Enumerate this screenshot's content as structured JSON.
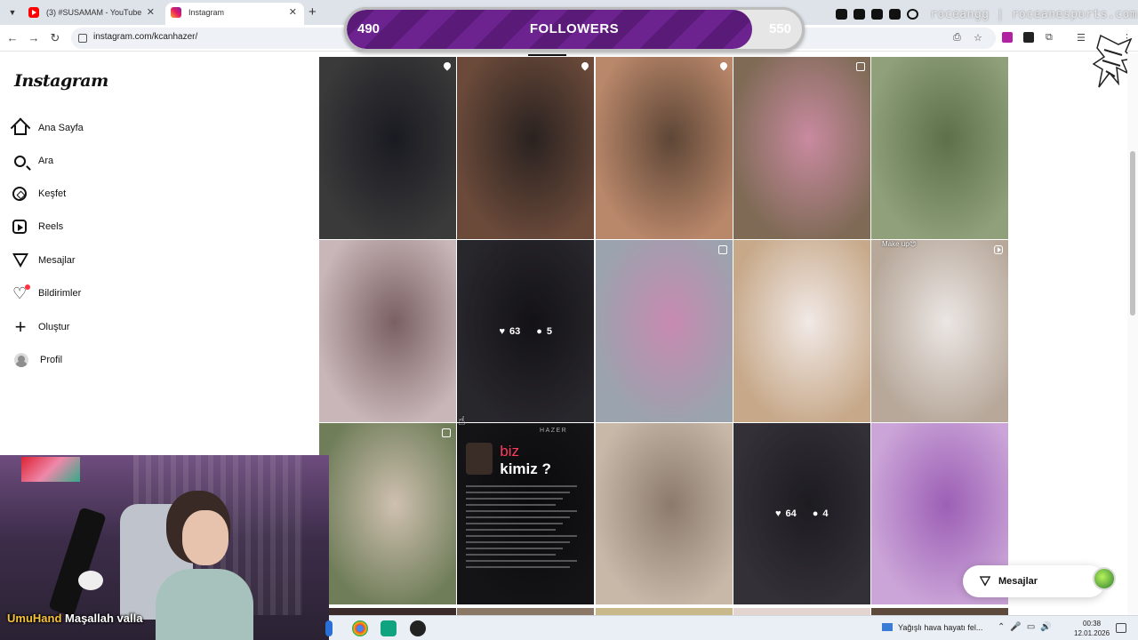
{
  "browser": {
    "tabs": [
      {
        "title": "(3) #SUSAMAM - YouTube",
        "icon": "youtube-icon"
      },
      {
        "title": "Instagram",
        "icon": "instagram-icon"
      }
    ],
    "url": "instagram.com/kcanhazer/"
  },
  "stream": {
    "goal": {
      "start": "490",
      "label": "FOLLOWERS",
      "end": "550",
      "progress": 0.89
    },
    "handles": "roceangg | roceanesports.com",
    "chat": {
      "user": "UmuHand",
      "message": "Maşallah valla"
    }
  },
  "sidebar": {
    "logo": "Instagram",
    "items": [
      {
        "label": "Ana Sayfa",
        "icon": "home-icon"
      },
      {
        "label": "Ara",
        "icon": "search-icon"
      },
      {
        "label": "Keşfet",
        "icon": "compass-icon"
      },
      {
        "label": "Reels",
        "icon": "reels-icon"
      },
      {
        "label": "Mesajlar",
        "icon": "send-icon"
      },
      {
        "label": "Bildirimler",
        "icon": "heart-icon"
      },
      {
        "label": "Oluştur",
        "icon": "plus-icon"
      },
      {
        "label": "Profil",
        "icon": "avatar-icon"
      }
    ]
  },
  "grid": {
    "posts": [
      {
        "badge": "pin",
        "colors": [
          "#3a3a3a",
          "#1a1a22"
        ]
      },
      {
        "badge": "pin",
        "colors": [
          "#6b4a3a",
          "#2a2220"
        ]
      },
      {
        "badge": "pin",
        "colors": [
          "#b9876a",
          "#5e4636"
        ]
      },
      {
        "badge": "multi",
        "colors": [
          "#7e6a55",
          "#c98aa0"
        ]
      },
      {
        "badge": "",
        "colors": [
          "#8fa07a",
          "#5d7049"
        ]
      },
      {
        "badge": "",
        "colors": [
          "#c8b6b8",
          "#7a6062"
        ]
      },
      {
        "badge": "",
        "colors": [
          "#3a3840",
          "#1c1a20"
        ],
        "likes": "63",
        "comments": "5"
      },
      {
        "badge": "multi",
        "colors": [
          "#9aa3ae",
          "#c78ab0"
        ]
      },
      {
        "badge": "",
        "colors": [
          "#c7a98a",
          "#f1e9e6"
        ]
      },
      {
        "badge": "reel",
        "colors": [
          "#b7a89a",
          "#ebe6e4"
        ],
        "tag": "Make up😍"
      },
      {
        "badge": "multi",
        "colors": [
          "#6f7d59",
          "#cfc0b0"
        ]
      },
      {
        "badge": "",
        "colors": [
          "#141416",
          "#0a0a0c"
        ],
        "brand": "HAZER",
        "title_accent": "biz",
        "title": "kimiz ?"
      },
      {
        "badge": "",
        "colors": [
          "#c7b8a8",
          "#8c7b6d"
        ]
      },
      {
        "badge": "",
        "colors": [
          "#4a4650",
          "#2a2830"
        ],
        "likes": "64",
        "comments": "4"
      },
      {
        "badge": "",
        "colors": [
          "#cba5d8",
          "#9c5fb5"
        ]
      }
    ]
  },
  "messages_pill": {
    "label": "Mesajlar"
  },
  "taskbar": {
    "weather": "Yağışlı hava hayatı fel...",
    "time": "00:38",
    "date": "12.01.2026"
  }
}
